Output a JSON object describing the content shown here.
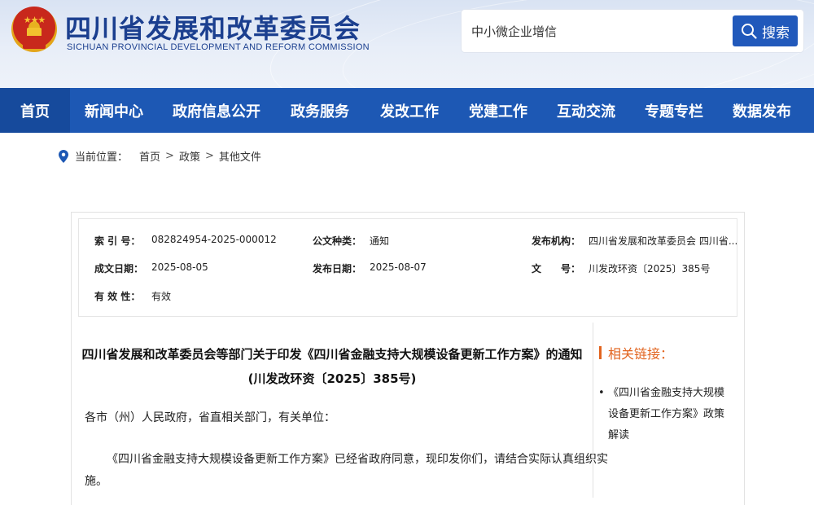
{
  "header": {
    "site_title": "四川省发展和改革委员会",
    "site_subtitle": "SICHUAN PROVINCIAL DEVELOPMENT AND REFORM COMMISSION",
    "emblem_icon": "national-emblem"
  },
  "search": {
    "value": "中小微企业增信",
    "button_label": "搜索",
    "button_icon": "search-icon"
  },
  "nav": {
    "items": [
      {
        "label": "首页",
        "active": true
      },
      {
        "label": "新闻中心"
      },
      {
        "label": "政府信息公开"
      },
      {
        "label": "政务服务"
      },
      {
        "label": "发改工作"
      },
      {
        "label": "党建工作"
      },
      {
        "label": "互动交流"
      },
      {
        "label": "专题专栏"
      },
      {
        "label": "数据发布"
      }
    ]
  },
  "breadcrumb": {
    "prefix": "当前位置：",
    "items": [
      "首页",
      "政策",
      "其他文件"
    ],
    "separator": ">"
  },
  "meta": {
    "index_no_label": "索 引 号：",
    "index_no": "082824954-2025-000012",
    "doc_type_label": "公文种类：",
    "doc_type": "通知",
    "issuer_label": "发布机构：",
    "issuer": "四川省发展和改革委员会 四川省...",
    "created_label": "成文日期：",
    "created": "2025-08-05",
    "published_label": "发布日期：",
    "published": "2025-08-07",
    "doc_no_label": "文　　号：",
    "doc_no": "川发改环资〔2025〕385号",
    "validity_label": "有 效 性：",
    "validity": "有效"
  },
  "article": {
    "title_line1": "四川省发展和改革委员会等部门关于印发《四川省金融支持大规模设备更新工作方案》的通知",
    "title_line2": "(川发改环资〔2025〕385号)",
    "salutation": "各市（州）人民政府，省直相关部门，有关单位：",
    "body_line1": "《四川省金融支持大规模设备更新工作方案》已经省政府同意，现印发你们，请结合实际认真组织实",
    "body_line2": "施。"
  },
  "sidebar": {
    "title": "相关链接：",
    "links": [
      {
        "line1": "《四川省金融支持大规模",
        "line2": "设备更新工作方案》政策",
        "line3": "解读"
      }
    ]
  },
  "colors": {
    "brand_blue": "#1d58b4",
    "nav_active": "#164a9c",
    "accent_orange": "#e2641f",
    "title_blue": "#1b3f8f"
  }
}
